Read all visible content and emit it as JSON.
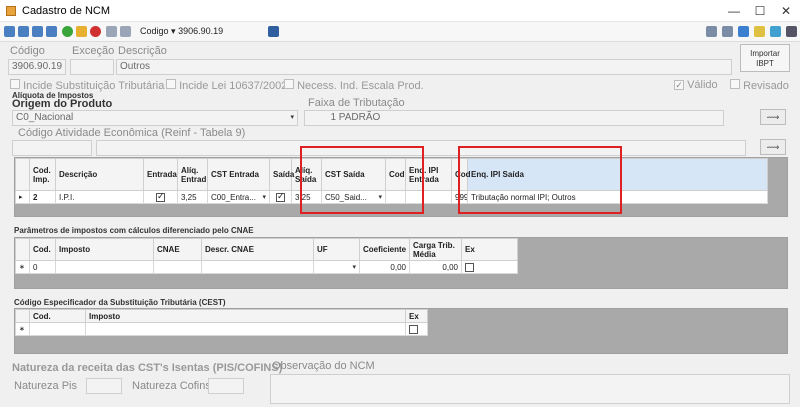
{
  "window": {
    "title": "Cadastro de NCM"
  },
  "toolbar": {
    "codigo_label": "Codigo",
    "codigo_value": "3906.90.19"
  },
  "header": {
    "codigo_label": "Código",
    "excecao_label": "Exceção",
    "descricao_label": "Descrição",
    "codigo_value": "3906.90.19",
    "excecao_value": "",
    "descricao_value": "Outros",
    "importar_label": "Importar IBPT"
  },
  "flags": {
    "incide_st": "Incide Substituição Tributária",
    "incide_lei": "Incide Lei 10637/2002",
    "necess_ind": "Necess. Ind. Escala Prod.",
    "valido": "Válido",
    "revisado": "Revisado"
  },
  "aliquota": {
    "section": "Alíquota de Impostos",
    "origem_label": "Origem do Produto",
    "origem_value": "C0_Nacional",
    "faixa_label": "Faixa de Tributação",
    "faixa_num": "1",
    "faixa_value": "PADRÃO",
    "atividade_label": "Código Atividade Econômica (Reinf - Tabela 9)"
  },
  "impostos_grid": {
    "headers": [
      "Cod. Imp.",
      "Descrição",
      "Entrada",
      "Alíq. Entrad",
      "CST Entrada",
      "Saída",
      "Alíq. Saída",
      "CST Saída",
      "Cod",
      "Enq. IPI Entrada",
      "Cod",
      "Enq. IPI Saída"
    ],
    "row": {
      "cod": "2",
      "descricao": "I.P.I.",
      "aliq_entrada": "3,25",
      "cst_entrada": "C00_Entra...",
      "aliq_saida": "3,25",
      "cst_saida": "C50_Said...",
      "cod_saida": "999",
      "enq_saida": "Tributação normal IPI; Outros"
    }
  },
  "cnae": {
    "section": "Parâmetros de impostos com cálculos diferenciado pelo CNAE",
    "headers": [
      "Cod.",
      "Imposto",
      "CNAE",
      "Descr. CNAE",
      "UF",
      "Coeficiente",
      "Carga Trib. Média",
      "Ex"
    ],
    "row": {
      "cod": "0",
      "coeficiente": "0,00",
      "carga": "0,00"
    }
  },
  "cest": {
    "section": "Código Especificador da Substituição Tributária (CEST)",
    "headers": [
      "Cod.",
      "Imposto",
      "Ex"
    ]
  },
  "natureza": {
    "section": "Natureza da receita das CST's Isentas (PIS/COFINS)",
    "pis_label": "Natureza Pis",
    "cofins_label": "Natureza Cofins"
  },
  "observacao": {
    "label": "Observação do NCM"
  }
}
